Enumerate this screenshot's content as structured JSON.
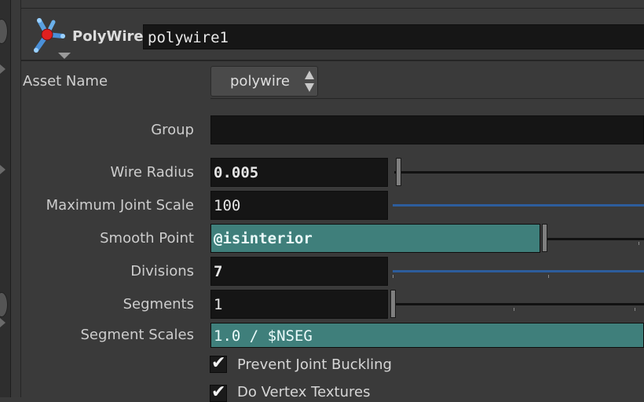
{
  "header": {
    "node_type": "PolyWire",
    "node_name": "polywire1"
  },
  "asset": {
    "label": "Asset Name",
    "value": "polywire"
  },
  "params": {
    "group": {
      "label": "Group",
      "value": ""
    },
    "wire_radius": {
      "label": "Wire Radius",
      "value": "0.005",
      "slider_fraction": 0.0
    },
    "max_joint_scale": {
      "label": "Maximum Joint Scale",
      "value": "100",
      "slider_fraction": 1.0
    },
    "smooth_point": {
      "label": "Smooth Point",
      "value": "@isinterior"
    },
    "divisions": {
      "label": "Divisions",
      "value": "7",
      "slider_fraction": 1.0
    },
    "segments": {
      "label": "Segments",
      "value": "1",
      "slider_fraction": 0.0
    },
    "segment_scales": {
      "label": "Segment Scales",
      "value": "1.0 / $NSEG"
    }
  },
  "toggles": {
    "prevent_joint_buckling": {
      "label": "Prevent Joint Buckling",
      "checked": true
    },
    "do_vertex_textures": {
      "label": "Do Vertex Textures",
      "checked": true
    }
  },
  "icons": [
    "polywire-node-icon",
    "menu-caret-icon",
    "menu-arrows-icon",
    "checkmark-icon"
  ],
  "colors": {
    "expression_field": "#3f7f7b",
    "slider_fill": "#2d5d9c",
    "background": "#3a3a3a"
  }
}
